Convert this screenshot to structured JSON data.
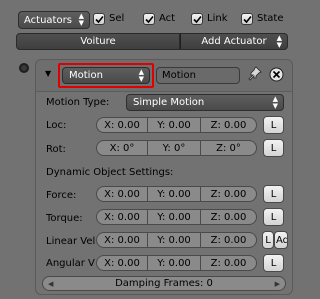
{
  "toolbar": {
    "category_dropdown": "Actuators",
    "checks": [
      {
        "label": "Sel",
        "checked": true
      },
      {
        "label": "Act",
        "checked": true
      },
      {
        "label": "Link",
        "checked": true
      },
      {
        "label": "State",
        "checked": true
      }
    ],
    "object_name": "Voiture",
    "add_actuator": "Add Actuator"
  },
  "actuator": {
    "type_dropdown": "Motion",
    "name": "Motion",
    "motion_type_label": "Motion Type:",
    "motion_type_value": "Simple Motion",
    "loc": {
      "label": "Loc:",
      "x": "X: 0.00",
      "y": "Y: 0.00",
      "z": "Z: 0.00",
      "l": "L"
    },
    "rot": {
      "label": "Rot:",
      "x": "X: 0°",
      "y": "Y: 0°",
      "z": "Z: 0°",
      "l": "L"
    },
    "dynamic_header": "Dynamic Object Settings:",
    "force": {
      "label": "Force:",
      "x": "X: 0.00",
      "y": "Y: 0.00",
      "z": "Z: 0.00",
      "l": "L"
    },
    "torque": {
      "label": "Torque:",
      "x": "X: 0.00",
      "y": "Y: 0.00",
      "z": "Z: 0.00",
      "l": "L"
    },
    "linear_vel": {
      "label": "Linear Vel",
      "x": "X: 0.00",
      "y": "Y: 0.00",
      "z": "Z: 0.00",
      "l": "L",
      "add": "Ad"
    },
    "angular_vel": {
      "label": "Angular V",
      "x": "X: 0.00",
      "y": "Y: 0.00",
      "z": "Z: 0.00",
      "l": "L"
    },
    "damping": "Damping Frames: 0"
  }
}
